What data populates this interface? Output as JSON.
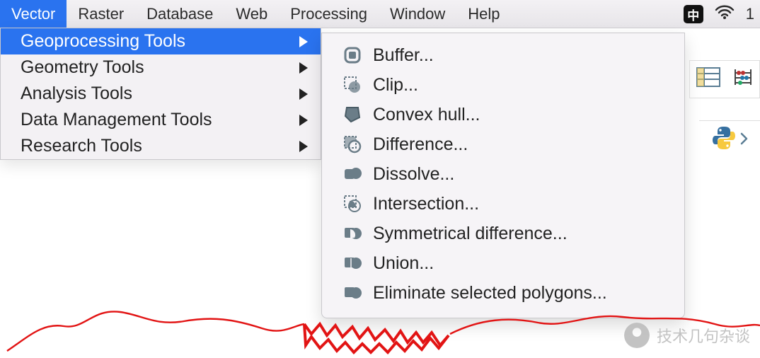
{
  "menubar": {
    "items": [
      {
        "label": "Vector",
        "active": true
      },
      {
        "label": "Raster",
        "active": false
      },
      {
        "label": "Database",
        "active": false
      },
      {
        "label": "Web",
        "active": false
      },
      {
        "label": "Processing",
        "active": false
      },
      {
        "label": "Window",
        "active": false
      },
      {
        "label": "Help",
        "active": false
      }
    ],
    "right": {
      "ime_badge": "中",
      "clock_text": "1"
    }
  },
  "vector_menu": {
    "items": [
      {
        "label": "Geoprocessing Tools",
        "has_submenu": true,
        "highlight": true
      },
      {
        "label": "Geometry Tools",
        "has_submenu": true,
        "highlight": false
      },
      {
        "label": "Analysis Tools",
        "has_submenu": true,
        "highlight": false
      },
      {
        "label": "Data Management Tools",
        "has_submenu": true,
        "highlight": false
      },
      {
        "label": "Research Tools",
        "has_submenu": true,
        "highlight": false
      }
    ]
  },
  "geoprocessing_submenu": {
    "items": [
      {
        "label": "Buffer...",
        "icon": "buffer-icon"
      },
      {
        "label": "Clip...",
        "icon": "clip-icon"
      },
      {
        "label": "Convex hull...",
        "icon": "convex-hull-icon"
      },
      {
        "label": "Difference...",
        "icon": "difference-icon"
      },
      {
        "label": "Dissolve...",
        "icon": "dissolve-icon"
      },
      {
        "label": "Intersection...",
        "icon": "intersection-icon"
      },
      {
        "label": "Symmetrical difference...",
        "icon": "sym-difference-icon"
      },
      {
        "label": "Union...",
        "icon": "union-icon"
      },
      {
        "label": "Eliminate selected polygons...",
        "icon": "eliminate-icon"
      }
    ]
  },
  "watermark": {
    "text": "技术几句杂谈"
  }
}
